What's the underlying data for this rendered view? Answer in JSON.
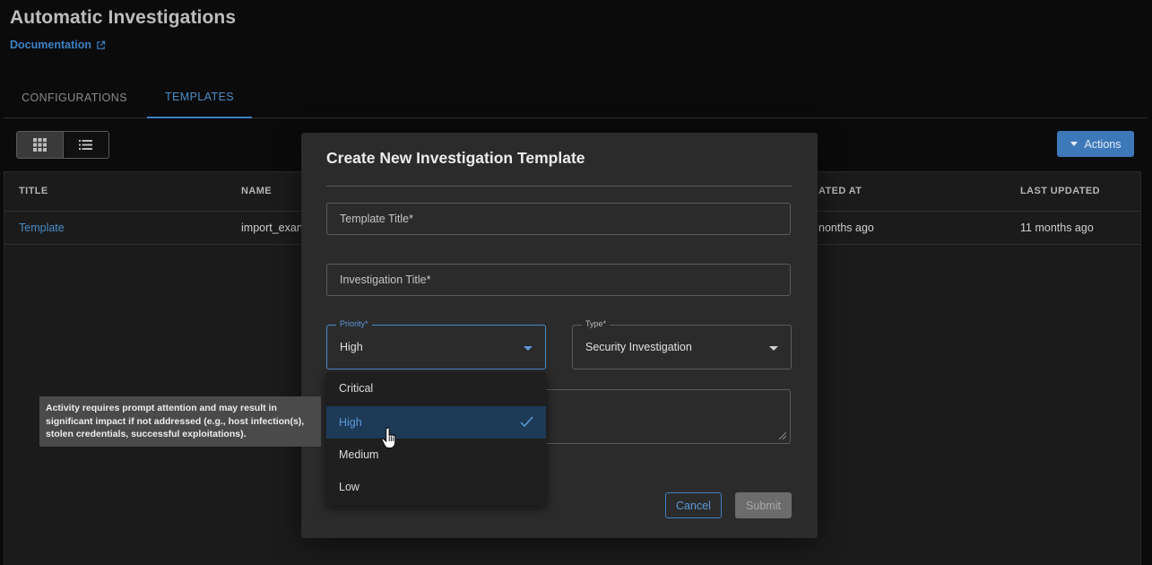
{
  "header": {
    "title": "Automatic Investigations",
    "documentation_label": "Documentation"
  },
  "tabs": [
    {
      "label": "CONFIGURATIONS",
      "active": false
    },
    {
      "label": "TEMPLATES",
      "active": true
    }
  ],
  "toolbar": {
    "grid_view_icon": "grid-icon",
    "list_view_icon": "list-icon",
    "actions_label": "Actions"
  },
  "table": {
    "columns": [
      "TITLE",
      "NAME",
      "ATED AT",
      "LAST UPDATED"
    ],
    "rows": [
      {
        "title": "Template",
        "name": "import_exan",
        "created": "nonths ago",
        "updated": "11 months ago"
      }
    ]
  },
  "modal": {
    "title": "Create New Investigation Template",
    "template_title_placeholder": "Template Title*",
    "investigation_title_placeholder": "Investigation Title*",
    "priority_label": "Priority*",
    "priority_value": "High",
    "type_label": "Type*",
    "type_value": "Security Investigation",
    "cancel_label": "Cancel",
    "submit_label": "Submit"
  },
  "priority_options": [
    {
      "label": "Critical",
      "selected": false
    },
    {
      "label": "High",
      "selected": true
    },
    {
      "label": "Medium",
      "selected": false
    },
    {
      "label": "Low",
      "selected": false
    }
  ],
  "tooltip": {
    "text": "Activity requires prompt attention and may result in significant impact if not addressed (e.g., host infection(s), stolen credentials, successful exploitations)."
  },
  "colors": {
    "accent": "#3d7fc1",
    "background": "#0b0b0c",
    "modal_bg": "#2b2b2c",
    "selected_option_bg": "#1d3a57"
  }
}
